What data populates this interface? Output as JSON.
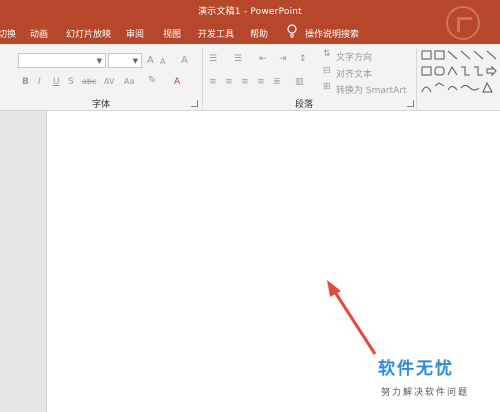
{
  "window": {
    "title": "演示文稿1  -  PowerPoint"
  },
  "menu": {
    "tabs": [
      "切换",
      "动画",
      "幻灯片放映",
      "审阅",
      "视图",
      "开发工具",
      "帮助"
    ],
    "tell_me": "操作说明搜索"
  },
  "ribbon": {
    "groups": {
      "font": "字体",
      "paragraph": "段落"
    },
    "paragraph": {
      "text_direction": "文字方向",
      "align_text": "对齐文本",
      "convert_smartart": "转换为 SmartArt"
    },
    "font_buttons": {
      "bold": "B",
      "italic": "I",
      "underline": "U",
      "shadow": "S",
      "strike": "abc",
      "spacing": "AV",
      "case": "Aa",
      "grow": "A",
      "shrink": "A",
      "clear": "A",
      "font_color": "A"
    }
  },
  "watermark": {
    "title": "软件无忧",
    "subtitle": "努力解决软件问题"
  },
  "colors": {
    "accent": "#b7472a",
    "watermark": "#2d8bd8",
    "arrow": "#e34a3c"
  }
}
